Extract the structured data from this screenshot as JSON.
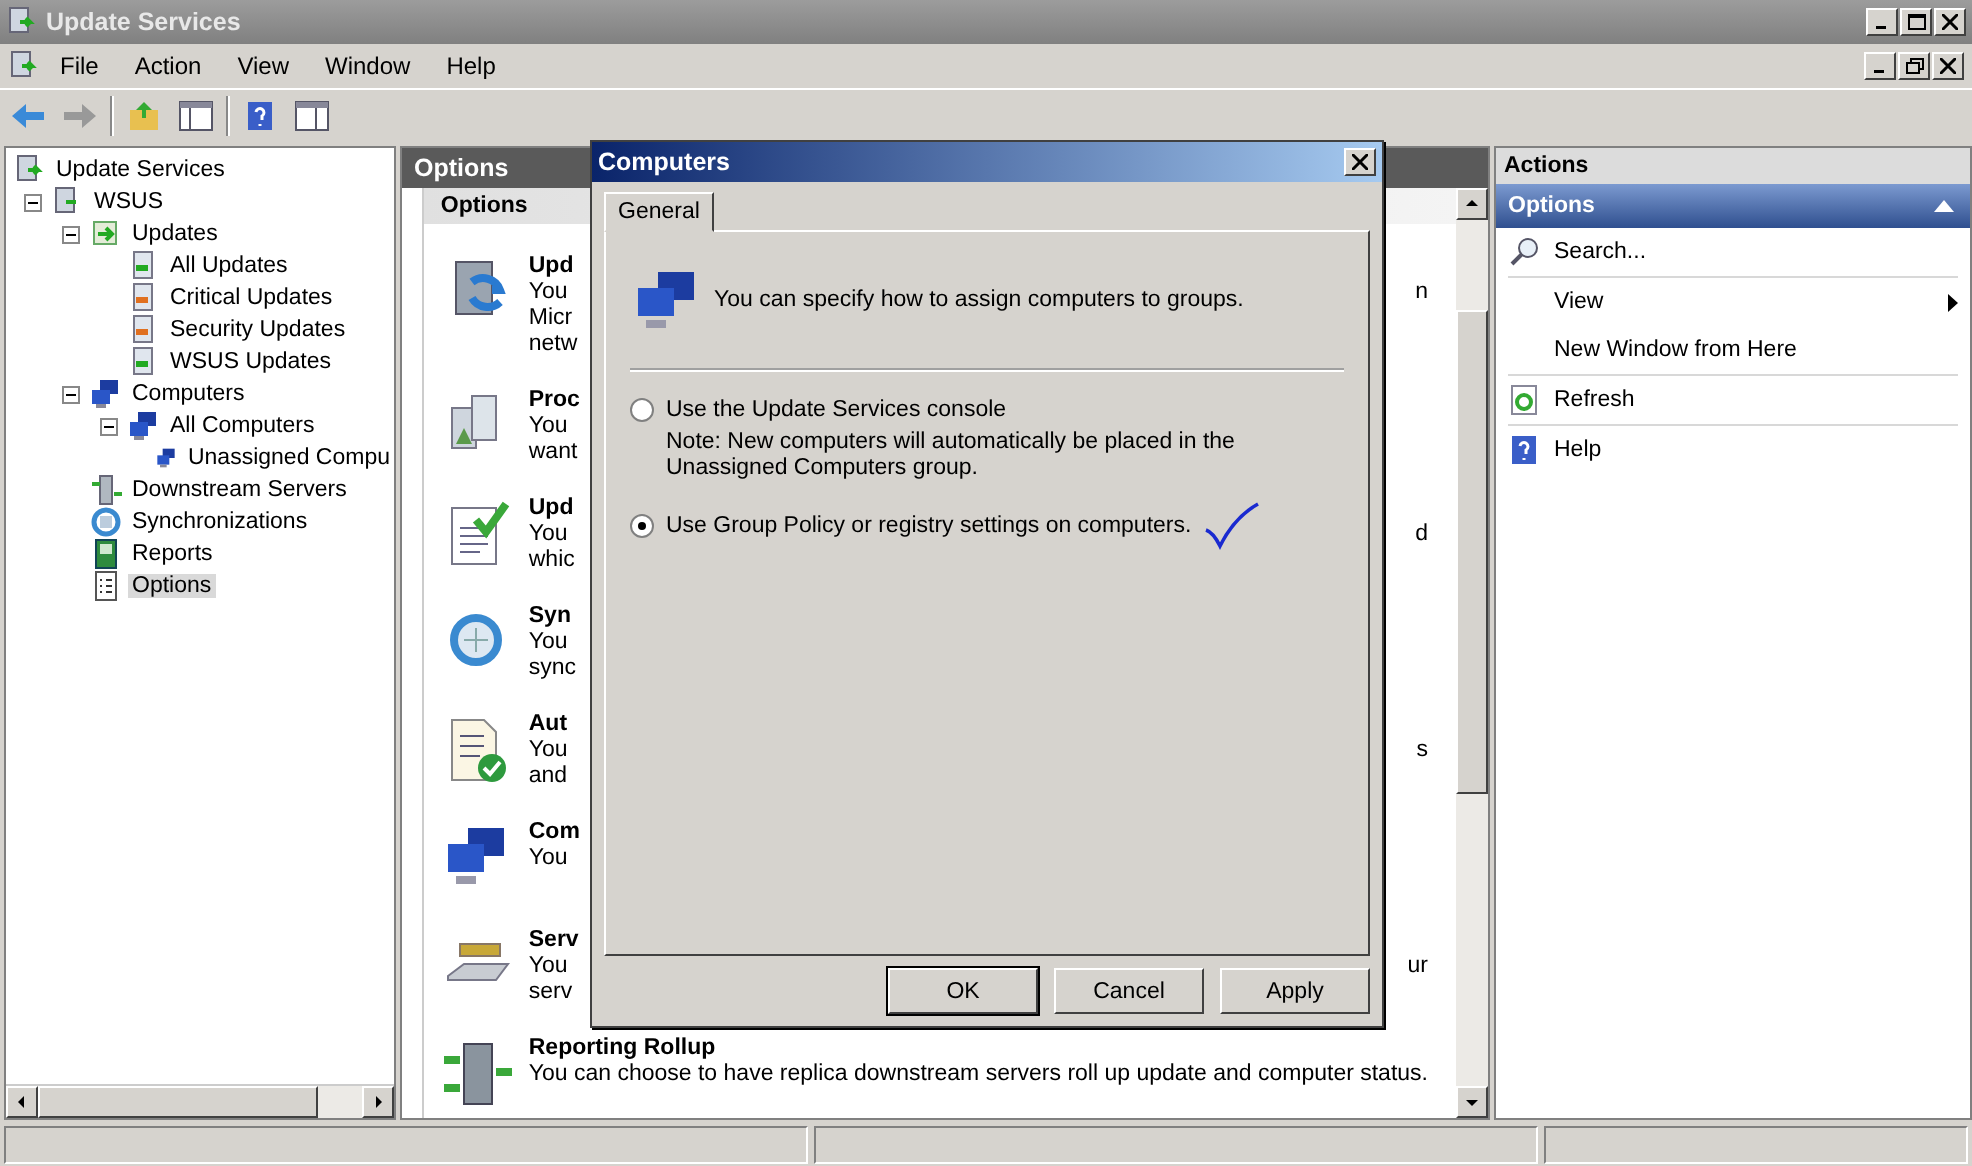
{
  "window": {
    "title": "Update Services"
  },
  "menu": [
    "File",
    "Action",
    "View",
    "Window",
    "Help"
  ],
  "tree": [
    {
      "label": "Update Services",
      "kind": "root",
      "selected": false,
      "children": [
        {
          "label": "WSUS",
          "kind": "server",
          "selected": false,
          "expanded": true,
          "children": [
            {
              "label": "Updates",
              "kind": "updates",
              "selected": false,
              "expanded": true,
              "children": [
                {
                  "label": "All Updates",
                  "kind": "update-green",
                  "selected": false
                },
                {
                  "label": "Critical Updates",
                  "kind": "update-orange",
                  "selected": false
                },
                {
                  "label": "Security Updates",
                  "kind": "update-orange",
                  "selected": false
                },
                {
                  "label": "WSUS Updates",
                  "kind": "update-green",
                  "selected": false
                }
              ]
            },
            {
              "label": "Computers",
              "kind": "computers",
              "selected": false,
              "expanded": true,
              "children": [
                {
                  "label": "All Computers",
                  "kind": "computers",
                  "selected": false,
                  "expanded": true,
                  "children": [
                    {
                      "label": "Unassigned Compu",
                      "kind": "computers",
                      "selected": false
                    }
                  ]
                }
              ]
            },
            {
              "label": "Downstream Servers",
              "kind": "downstream",
              "selected": false
            },
            {
              "label": "Synchronizations",
              "kind": "sync",
              "selected": false
            },
            {
              "label": "Reports",
              "kind": "reports",
              "selected": false
            },
            {
              "label": "Options",
              "kind": "options",
              "selected": true
            }
          ]
        }
      ]
    }
  ],
  "content": {
    "header": "Options",
    "subheader": "Options",
    "items": [
      {
        "kind": "server-update",
        "title": "Upd",
        "lines": [
          "You",
          "Micr",
          "netw"
        ],
        "tail": "n"
      },
      {
        "kind": "products",
        "title": "Proc",
        "lines": [
          "You",
          "want"
        ]
      },
      {
        "kind": "doc-check",
        "title": "Upd",
        "lines": [
          "You",
          "whic"
        ],
        "tail": "d"
      },
      {
        "kind": "sync",
        "title": "Syn",
        "lines": [
          "You",
          "sync"
        ]
      },
      {
        "kind": "list-check",
        "title": "Aut",
        "lines": [
          "You",
          "and"
        ],
        "tail": "s"
      },
      {
        "kind": "computers",
        "title": "Com",
        "lines": [
          "You"
        ]
      },
      {
        "kind": "server-tray",
        "title": "Serv",
        "lines": [
          "You",
          "serv"
        ],
        "tail": "ur"
      },
      {
        "kind": "rollup",
        "title": "Reporting Rollup",
        "lines": [
          "You can choose to have replica downstream servers roll up update and computer status."
        ]
      }
    ]
  },
  "dialog": {
    "title": "Computers",
    "tabs": [
      {
        "label": "General",
        "selected": true
      }
    ],
    "intro": "You can specify how to assign computers to groups.",
    "options": [
      {
        "label": "Use the Update Services console",
        "note": "Note: New computers will automatically be placed in the Unassigned Computers group.",
        "selected": false,
        "marked": false
      },
      {
        "label": "Use Group Policy or registry settings on computers.",
        "selected": true,
        "marked": true
      }
    ],
    "buttons": [
      {
        "label": "OK",
        "default": true
      },
      {
        "label": "Cancel",
        "default": false
      },
      {
        "label": "Apply",
        "default": false
      }
    ]
  },
  "actions": {
    "title": "Actions",
    "section": "Options",
    "groups": [
      [
        {
          "label": "Search...",
          "kind": "search"
        }
      ],
      [
        {
          "label": "View",
          "kind": "submenu"
        },
        {
          "label": "New Window from Here",
          "kind": "plain"
        }
      ],
      [
        {
          "label": "Refresh",
          "kind": "refresh"
        }
      ],
      [
        {
          "label": "Help",
          "kind": "help"
        }
      ]
    ]
  }
}
